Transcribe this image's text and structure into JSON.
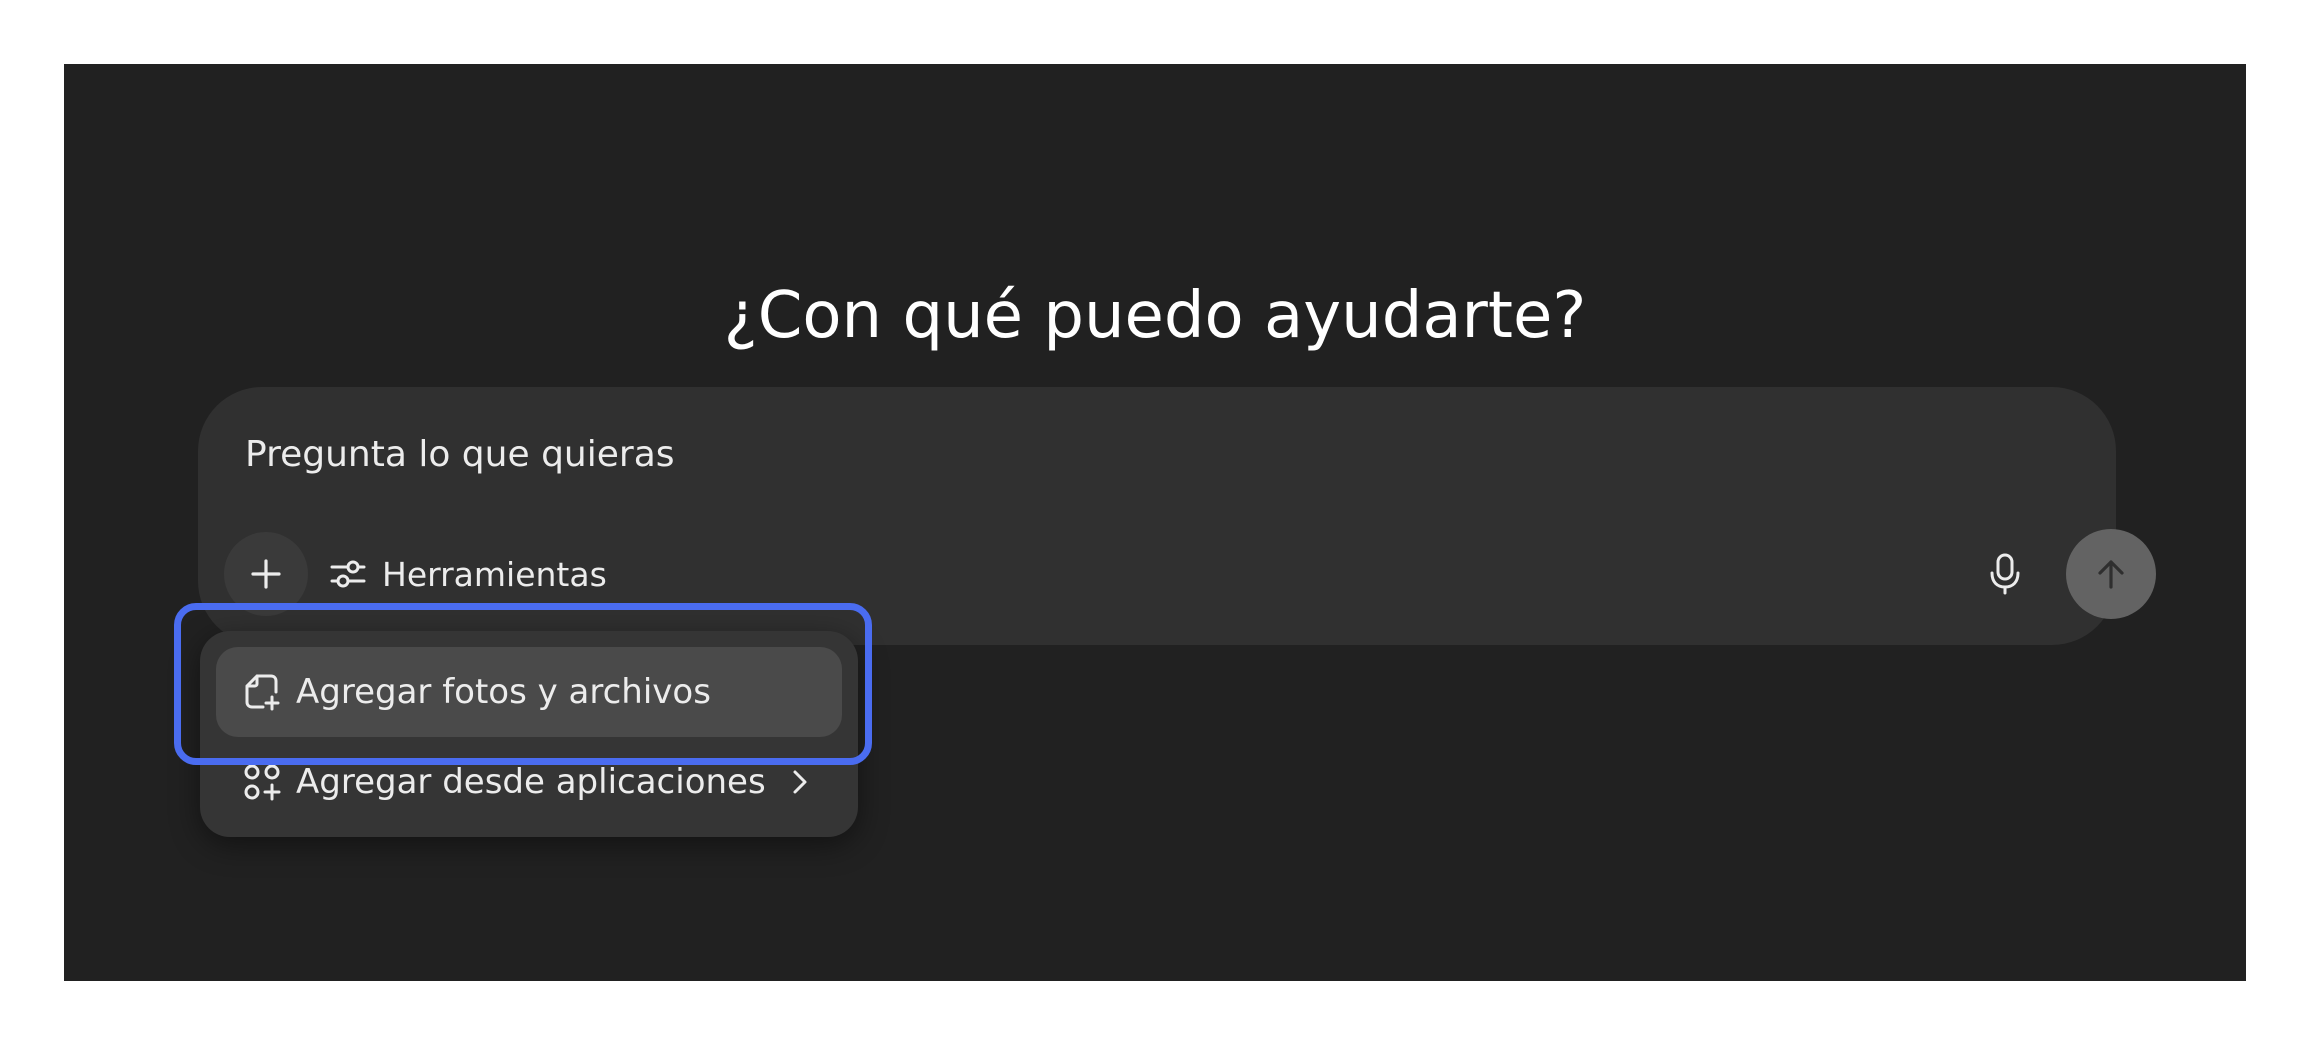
{
  "main": {
    "heading": "¿Con qué puedo ayudarte?"
  },
  "composer": {
    "placeholder": "Pregunta lo que quieras",
    "value": "",
    "plus_icon": "plus-icon",
    "tools_label": "Herramientas",
    "tools_icon": "sliders-icon",
    "mic_icon": "microphone-icon",
    "send_icon": "arrow-up-icon"
  },
  "attach_menu": {
    "items": [
      {
        "label": "Agregar fotos y archivos",
        "icon": "add-file-icon",
        "active": true
      },
      {
        "label": "Agregar desde aplicaciones",
        "icon": "apps-grid-icon",
        "has_submenu": true
      }
    ]
  },
  "colors": {
    "background": "#212121",
    "composer": "#303030",
    "menu": "#353535",
    "menu_active": "#4a4a4a",
    "send_button": "#636363",
    "highlight": "#4a6cf0"
  }
}
